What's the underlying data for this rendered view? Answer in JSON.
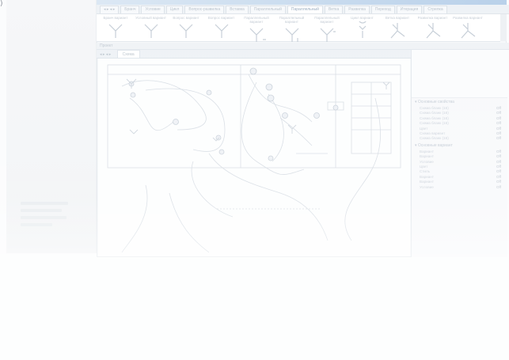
{
  "corner_marker": ")",
  "ribbon_tabs": [
    "◂ ▸ ◂ ▸",
    "Бранч",
    "Условие",
    "Цикл",
    "Вопрос-развилка",
    "Вставка",
    "Параллельный",
    "Параллельный",
    "Ветка",
    "Развилка",
    "Переход",
    "Итерация",
    "Стрелка"
  ],
  "palette": [
    {
      "label": "Бранч вариант",
      "icon": "fork-icon"
    },
    {
      "label": "Условный вариант",
      "icon": "fork-icon"
    },
    {
      "label": "Вопрос вариант",
      "icon": "fork-icon"
    },
    {
      "label": "Вопрос вариант",
      "icon": "fork-icon"
    },
    {
      "label": "Параллельный вариант",
      "icon": "fork-2-icon"
    },
    {
      "label": "Параллельный вариант",
      "icon": "fork-3-icon"
    },
    {
      "label": "Параллельный вариант",
      "icon": "fork-4-icon"
    },
    {
      "label": "Цикл вариант",
      "icon": "loop-icon"
    },
    {
      "label": "Ветка вариант",
      "icon": "branch-icon"
    },
    {
      "label": "Развилка вариант",
      "icon": "branch-icon"
    },
    {
      "label": "Развилка вариант",
      "icon": "branch-icon"
    }
  ],
  "section_label": "Проект",
  "document_tab": "Схема",
  "properties": {
    "group1": "▾ Основные свойства",
    "rows1": [
      [
        "Схема бланк (16)",
        "Off"
      ],
      [
        "Схема бланк (16)",
        "Off"
      ],
      [
        "Схема бланк (16)",
        "Off"
      ],
      [
        "Схема бланк (16)",
        "Off"
      ],
      [
        "Цвет",
        "Off"
      ],
      [
        "Схема вариант",
        "Off"
      ],
      [
        "Схема бланк (16)",
        "Off"
      ]
    ],
    "group2": "▾ Основные вариант",
    "rows2": [
      [
        "Вариант",
        "Off"
      ],
      [
        "Вариант",
        "Off"
      ],
      [
        "Условие",
        "Off"
      ],
      [
        "Цвет",
        "Off"
      ],
      [
        "Стиль",
        "Off"
      ],
      [
        "Вариант",
        "Off"
      ],
      [
        "Вариант",
        "Off"
      ],
      [
        "Условие",
        "Off"
      ]
    ]
  },
  "colors": {
    "accent": "#b9d1ea",
    "line": "#d3dae2"
  }
}
